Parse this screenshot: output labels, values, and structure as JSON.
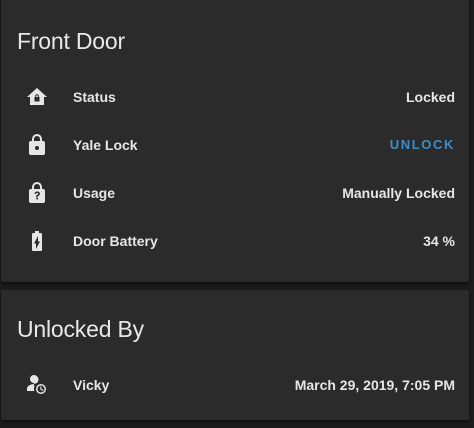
{
  "front_door": {
    "title": "Front Door",
    "rows": [
      {
        "icon": "home-lock-icon",
        "label": "Status",
        "value": "Locked"
      },
      {
        "icon": "lock-icon",
        "label": "Yale Lock",
        "action": "UNLOCK"
      },
      {
        "icon": "lock-question-icon",
        "label": "Usage",
        "value": "Manually Locked"
      },
      {
        "icon": "battery-charging-icon",
        "label": "Door Battery",
        "value": "34 %"
      }
    ]
  },
  "unlocked_by": {
    "title": "Unlocked By",
    "rows": [
      {
        "icon": "account-clock-icon",
        "label": "Vicky",
        "value": "March 29, 2019, 7:05 PM"
      }
    ]
  },
  "colors": {
    "background": "#1c1c1c",
    "card": "#2b2b2b",
    "text": "#e6e6e6",
    "accent": "#3d8ec5"
  }
}
